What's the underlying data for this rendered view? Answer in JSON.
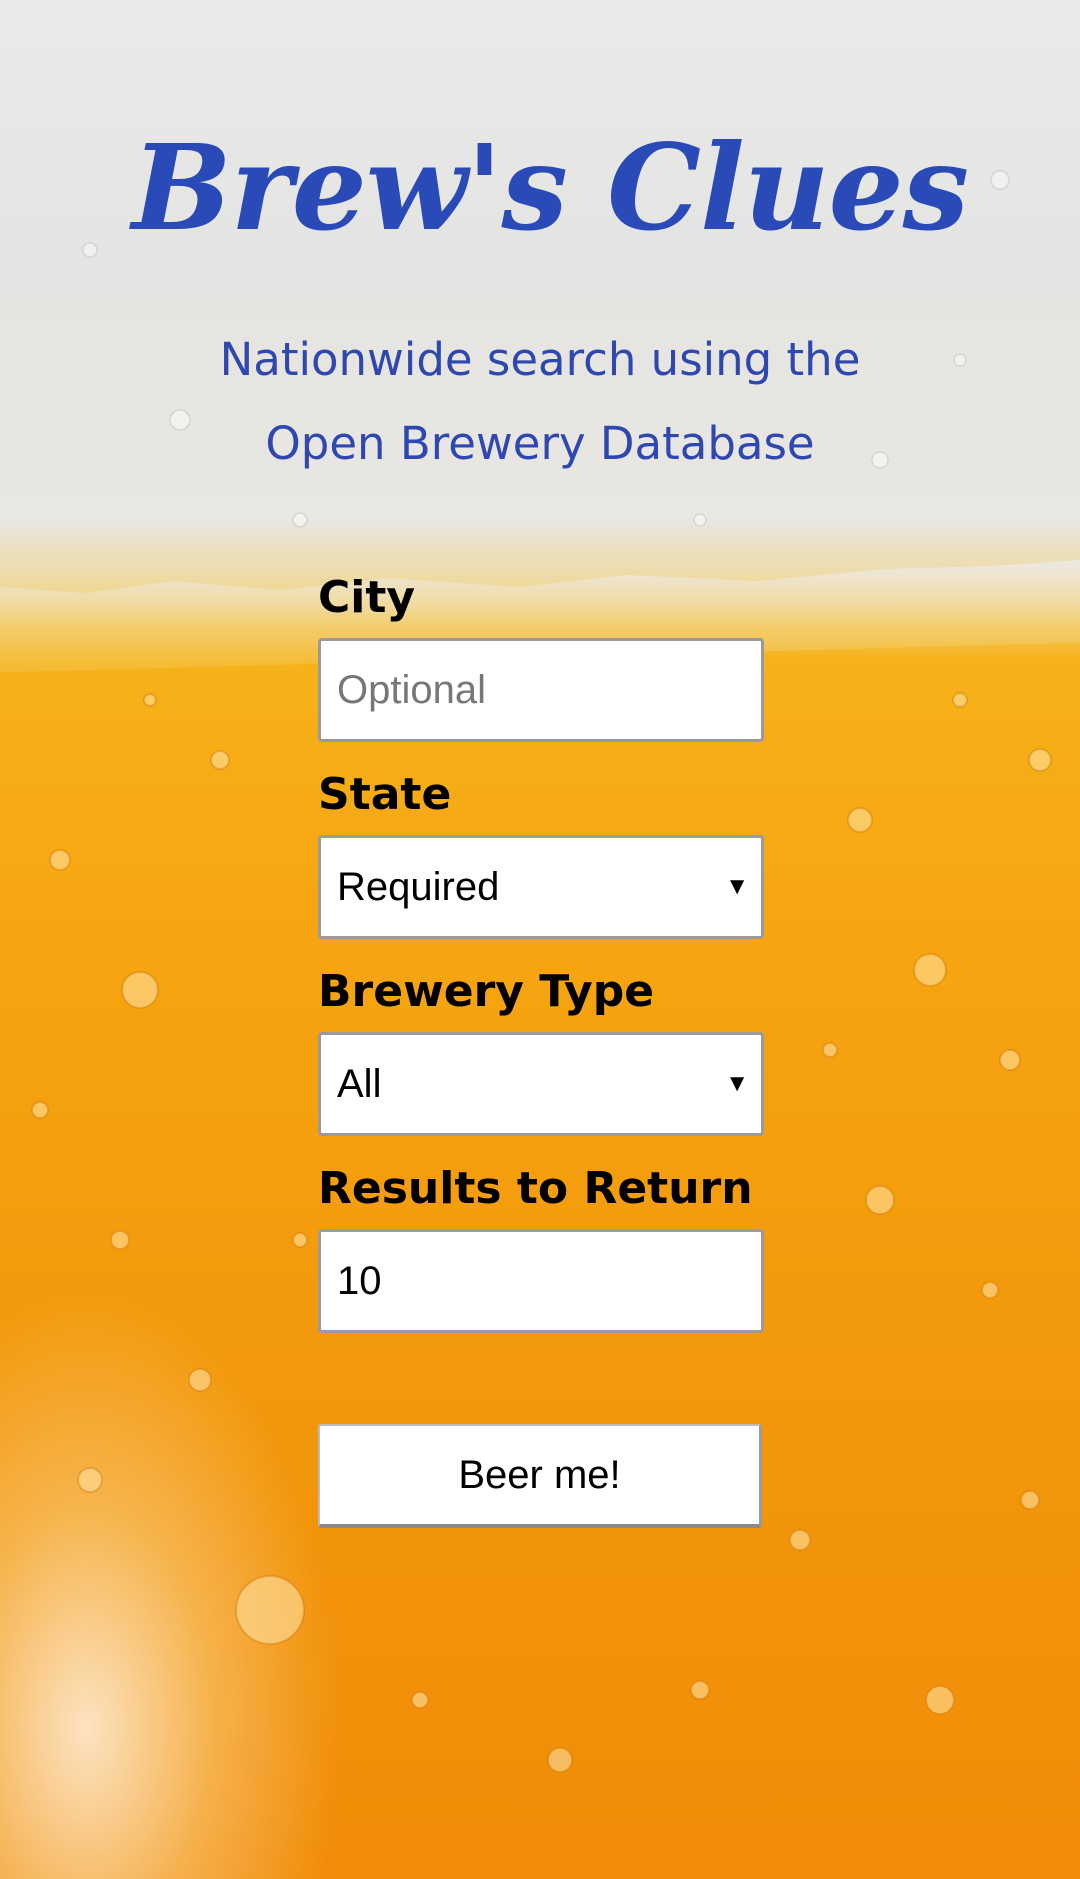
{
  "header": {
    "title": "Brew's Clues",
    "subtitle_line1": "Nationwide search using the",
    "subtitle_line2": "Open Brewery Database"
  },
  "form": {
    "city": {
      "label": "City",
      "value": "",
      "placeholder": "Optional"
    },
    "state": {
      "label": "State",
      "selected": "Required"
    },
    "brewery_type": {
      "label": "Brewery Type",
      "selected": "All"
    },
    "results": {
      "label": "Results to Return",
      "value": "10"
    },
    "submit_label": "Beer me!"
  },
  "colors": {
    "title": "#2a4ab7",
    "subtitle": "#2f48b0",
    "beer": "#f7a612",
    "foam": "#e9e7e3"
  }
}
